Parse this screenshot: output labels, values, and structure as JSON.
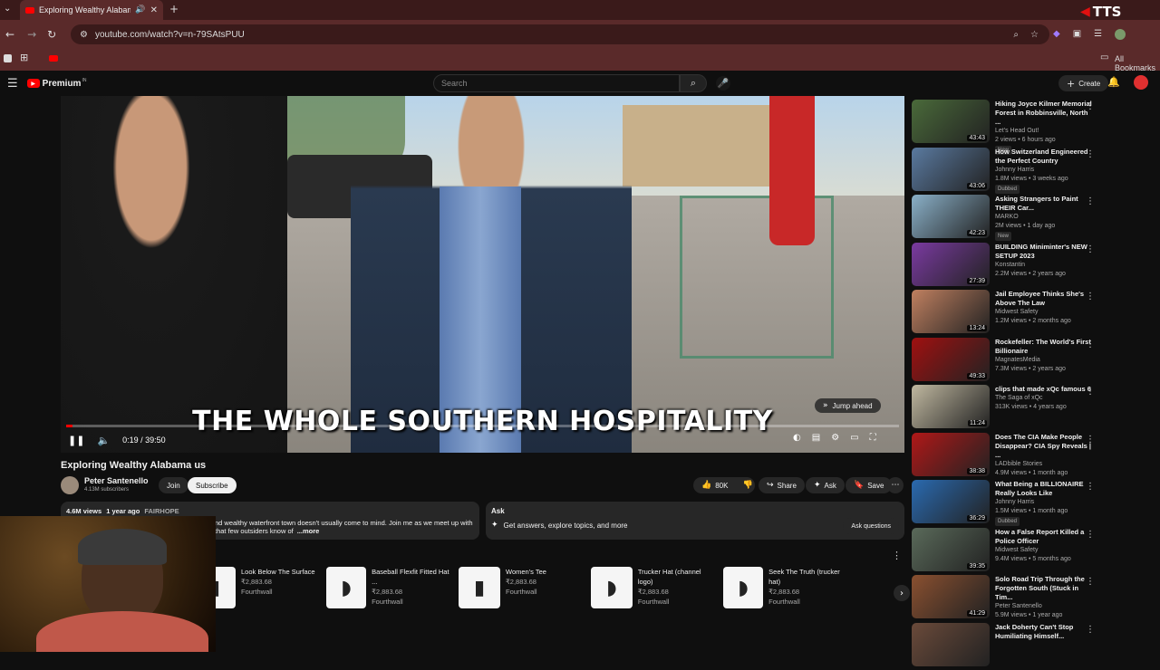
{
  "browser": {
    "tab_title": "Exploring Wealthy Alabama",
    "url": "youtube.com/watch?v=n-79SAtsPUU",
    "bookmarks_label": "All Bookmarks",
    "tts_label": "TTS"
  },
  "yt": {
    "logo_text": "Premium",
    "logo_badge": "IN",
    "search_placeholder": "Search",
    "create_label": "Create"
  },
  "video": {
    "subtitle": "THE WHOLE SOUTHERN HOSPITALITY",
    "time": "0:19 / 39:50",
    "progress": 0.008,
    "jump_ahead": "Jump ahead",
    "title": "Exploring Wealthy Alabama us",
    "channel": "Peter Santenello",
    "subscribers": "4.13M subscribers",
    "join": "Join",
    "subscribe": "Subscribe",
    "likes": "80K",
    "share": "Share",
    "ask": "Ask",
    "save": "Save",
    "views": "4.6M views",
    "age": "1 year ago",
    "location": "FAIRHOPE",
    "desc_line1": "nd wealthy waterfront town doesn't usually come to mind. Join me as we meet up with",
    "desc_line2": "that few outsiders know of",
    "desc_more": "...more"
  },
  "ask_box": {
    "title": "Ask",
    "prompt": "Get answers, explore topics, and more",
    "button": "Ask questions"
  },
  "shop": [
    {
      "name": "Look Below The Surface",
      "price": "₹2,883.68",
      "store": "Fourthwall"
    },
    {
      "name": "Baseball Flexfit Fitted Hat ...",
      "price": "₹2,883.68",
      "store": "Fourthwall"
    },
    {
      "name": "Women's Tee",
      "price": "₹2,883.68",
      "store": "Fourthwall"
    },
    {
      "name": "Trucker Hat (channel logo)",
      "price": "₹2,883.68",
      "store": "Fourthwall"
    },
    {
      "name": "Seek The Truth (trucker hat)",
      "price": "₹2,883.68",
      "store": "Fourthwall"
    }
  ],
  "recommendations": [
    {
      "title": "Hiking Joyce Kilmer Memorial Forest in Robbinsville, North ...",
      "channel": "Let's Head Out!",
      "meta": "2 views • 6 hours ago",
      "badge": "New",
      "duration": "43:43",
      "color": "#4a6a3a"
    },
    {
      "title": "How Switzerland Engineered the Perfect Country",
      "channel": "Johnny Harris",
      "meta": "1.8M views • 3 weeks ago",
      "badge": "Dubbed",
      "duration": "43:06",
      "color": "#5a7aa0"
    },
    {
      "title": "Asking Strangers to Paint THEIR Car...",
      "channel": "MARKO",
      "meta": "2M views • 1 day ago",
      "badge": "New",
      "duration": "42:23",
      "color": "#8ab0c8"
    },
    {
      "title": "BUILDING Miniminter's NEW SETUP 2023",
      "channel": "Konstantin",
      "meta": "2.2M views • 2 years ago",
      "badge": "",
      "duration": "27:39",
      "color": "#7a3aa0"
    },
    {
      "title": "Jail Employee Thinks She's Above The Law",
      "channel": "Midwest Safety",
      "meta": "1.2M views • 2 months ago",
      "badge": "",
      "duration": "13:24",
      "color": "#c08060"
    },
    {
      "title": "Rockefeller: The World's First Billionaire",
      "channel": "MagnatesMedia",
      "meta": "7.3M views • 2 years ago",
      "badge": "",
      "duration": "49:33",
      "color": "#a01010"
    },
    {
      "title": "clips that made xQc famous 6",
      "channel": "The Saga of xQc",
      "meta": "313K views • 4 years ago",
      "badge": "",
      "duration": "11:24",
      "color": "#c0b8a0"
    },
    {
      "title": "Does The CIA Make People Disappear? CIA Spy Reveals | ...",
      "channel": "LADbible Stories",
      "meta": "4.9M views • 1 month ago",
      "badge": "",
      "duration": "38:38",
      "color": "#b01818"
    },
    {
      "title": "What Being a BILLIONAIRE Really Looks Like",
      "channel": "Johnny Harris",
      "meta": "1.5M views • 1 month ago",
      "badge": "Dubbed",
      "duration": "36:29",
      "color": "#2a6ab0"
    },
    {
      "title": "How a False Report Killed a Police Officer",
      "channel": "Midwest Safety",
      "meta": "9.4M views • 5 months ago",
      "badge": "",
      "duration": "39:35",
      "color": "#5a6a5a"
    },
    {
      "title": "Solo Road Trip Through the Forgotten South (Stuck in Tim...",
      "channel": "Peter Santenello",
      "meta": "5.9M views • 1 year ago",
      "badge": "",
      "duration": "41:29",
      "color": "#8a5030"
    },
    {
      "title": "Jack Doherty Can't Stop Humiliating Himself...",
      "channel": "",
      "meta": "",
      "badge": "",
      "duration": "",
      "color": "#6a4a3a"
    }
  ]
}
